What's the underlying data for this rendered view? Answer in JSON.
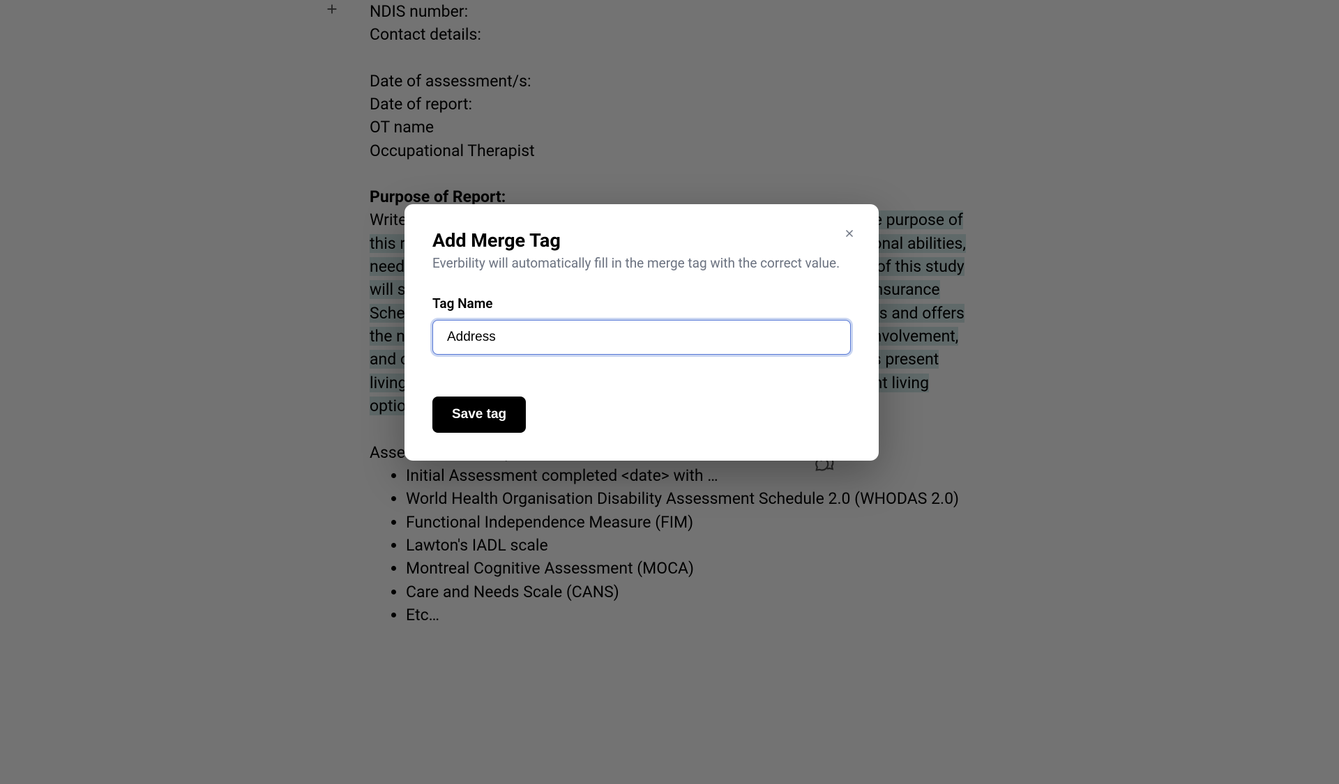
{
  "doc": {
    "lines_top": [
      "NDIS number:",
      "Contact details:",
      "",
      "Date of assessment/s:",
      "Date of report:",
      "OT name",
      "Occupational Therapist",
      ""
    ],
    "purpose_heading": "Purpose of Report:",
    "purpose_body_prefix": "Write a small paragraph that summarises the purpose of this report: ",
    "purpose_body_highlighted": "The purpose of this report is to conduct a holistic evaluation of <client>'s current functional abilities, needs, and aspirations in reference to their daily activities. The findings of this study will serve as a guide for the development of his/her National Disability Insurance Scheme (NDIS) plan, ensuring it aligns with <client>'s personal objectives and offers the necessary supports to enhance his/her independence, community involvement, and overall quality of life. Furthermore, this report will evaluate <client>'s present living conditions and specialist disability accommodation or independent living options to support NDIS plan and goals for 2023.",
    "assessments_heading": "Assessments Completed:",
    "assessments": [
      "Initial Assessment completed <date> with …",
      "World Health Organisation Disability Assessment Schedule 2.0 (WHODAS 2.0)",
      "Functional Independence Measure (FIM)",
      "Lawton's IADL scale",
      "Montreal Cognitive Assessment (MOCA)",
      "Care and Needs Scale (CANS)",
      "Etc…"
    ]
  },
  "modal": {
    "title": "Add Merge Tag",
    "subtitle": "Everbility will automatically fill in the merge tag with the correct value.",
    "label": "Tag Name",
    "input_value": "Address",
    "save_label": "Save tag"
  }
}
